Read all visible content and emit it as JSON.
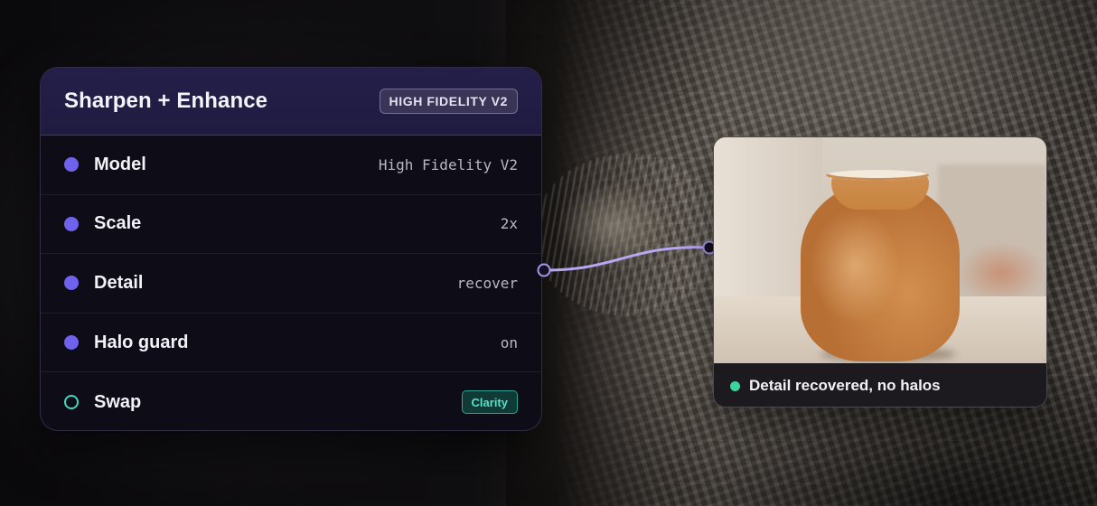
{
  "panel": {
    "title": "Sharpen + Enhance",
    "badge": "HIGH FIDELITY V2",
    "rows": [
      {
        "label": "Model",
        "value": "High Fidelity V2",
        "dot_style": "filled"
      },
      {
        "label": "Scale",
        "value": "2x",
        "dot_style": "filled"
      },
      {
        "label": "Detail",
        "value": "recover",
        "dot_style": "filled"
      },
      {
        "label": "Halo guard",
        "value": "on",
        "dot_style": "filled"
      },
      {
        "label": "Swap",
        "value": "Clarity",
        "dot_style": "hollow"
      }
    ]
  },
  "result": {
    "caption": "Detail recovered, no halos",
    "status": "success"
  },
  "colors": {
    "accent": "#6f62ec",
    "teal": "#3fd6c2",
    "success": "#3bd49a",
    "header_bg": "#241f4a"
  },
  "icons": {
    "filled_dot": "filled-node-dot-icon",
    "hollow_dot": "hollow-node-dot-icon",
    "status_dot": "status-dot-icon"
  }
}
